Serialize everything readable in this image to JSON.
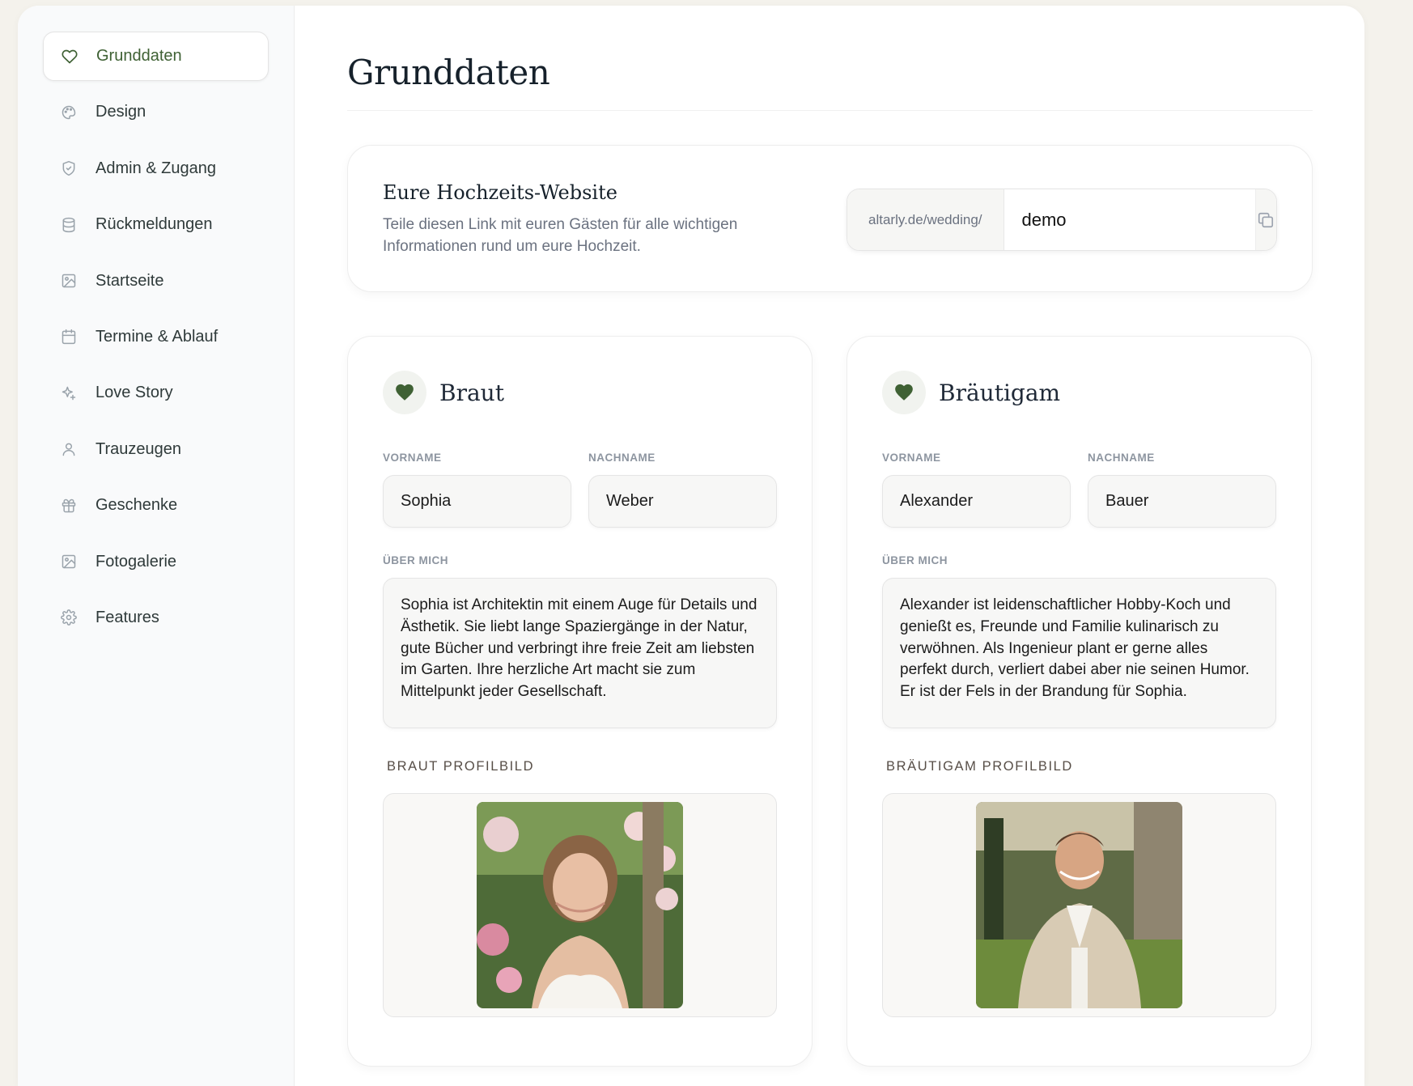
{
  "sidebar": {
    "items": [
      {
        "label": "Grunddaten",
        "icon": "heart-icon"
      },
      {
        "label": "Design",
        "icon": "palette-icon"
      },
      {
        "label": "Admin & Zugang",
        "icon": "shield-icon"
      },
      {
        "label": "Rückmeldungen",
        "icon": "database-icon"
      },
      {
        "label": "Startseite",
        "icon": "image-icon"
      },
      {
        "label": "Termine & Ablauf",
        "icon": "calendar-icon"
      },
      {
        "label": "Love Story",
        "icon": "sparkles-icon"
      },
      {
        "label": "Trauzeugen",
        "icon": "user-icon"
      },
      {
        "label": "Geschenke",
        "icon": "gift-icon"
      },
      {
        "label": "Fotogalerie",
        "icon": "image-icon"
      },
      {
        "label": "Features",
        "icon": "gear-icon"
      }
    ],
    "active_index": 0
  },
  "page": {
    "title": "Grunddaten"
  },
  "website": {
    "title": "Eure Hochzeits-Website",
    "description": "Teile diesen Link mit euren Gästen für alle wichtigen Informationen rund um eure Hochzeit.",
    "url_prefix": "altarly.de/wedding/",
    "slug": "demo"
  },
  "bride": {
    "title": "Braut",
    "first_name_label": "Vorname",
    "last_name_label": "Nachname",
    "first_name": "Sophia",
    "last_name": "Weber",
    "about_label": "Über mich",
    "about": "Sophia ist Architektin mit einem Auge für Details und Ästhetik. Sie liebt lange Spaziergänge in der Natur, gute Bücher und verbringt ihre freie Zeit am liebsten im Garten. Ihre herzliche Art macht sie zum Mittelpunkt jeder Gesellschaft.",
    "photo_label": "Braut Profilbild"
  },
  "groom": {
    "title": "Bräutigam",
    "first_name_label": "Vorname",
    "last_name_label": "Nachname",
    "first_name": "Alexander",
    "last_name": "Bauer",
    "about_label": "Über mich",
    "about": "Alexander ist leidenschaftlicher Hobby-Koch und genießt es, Freunde und Familie kulinarisch zu verwöhnen. Als Ingenieur plant er gerne alles perfekt durch, verliert dabei aber nie seinen Humor. Er ist der Fels in der Brandung für Sophia.",
    "photo_label": "Bräutigam Profilbild"
  },
  "colors": {
    "accent": "#3f6134",
    "background": "#f4f2ec"
  }
}
